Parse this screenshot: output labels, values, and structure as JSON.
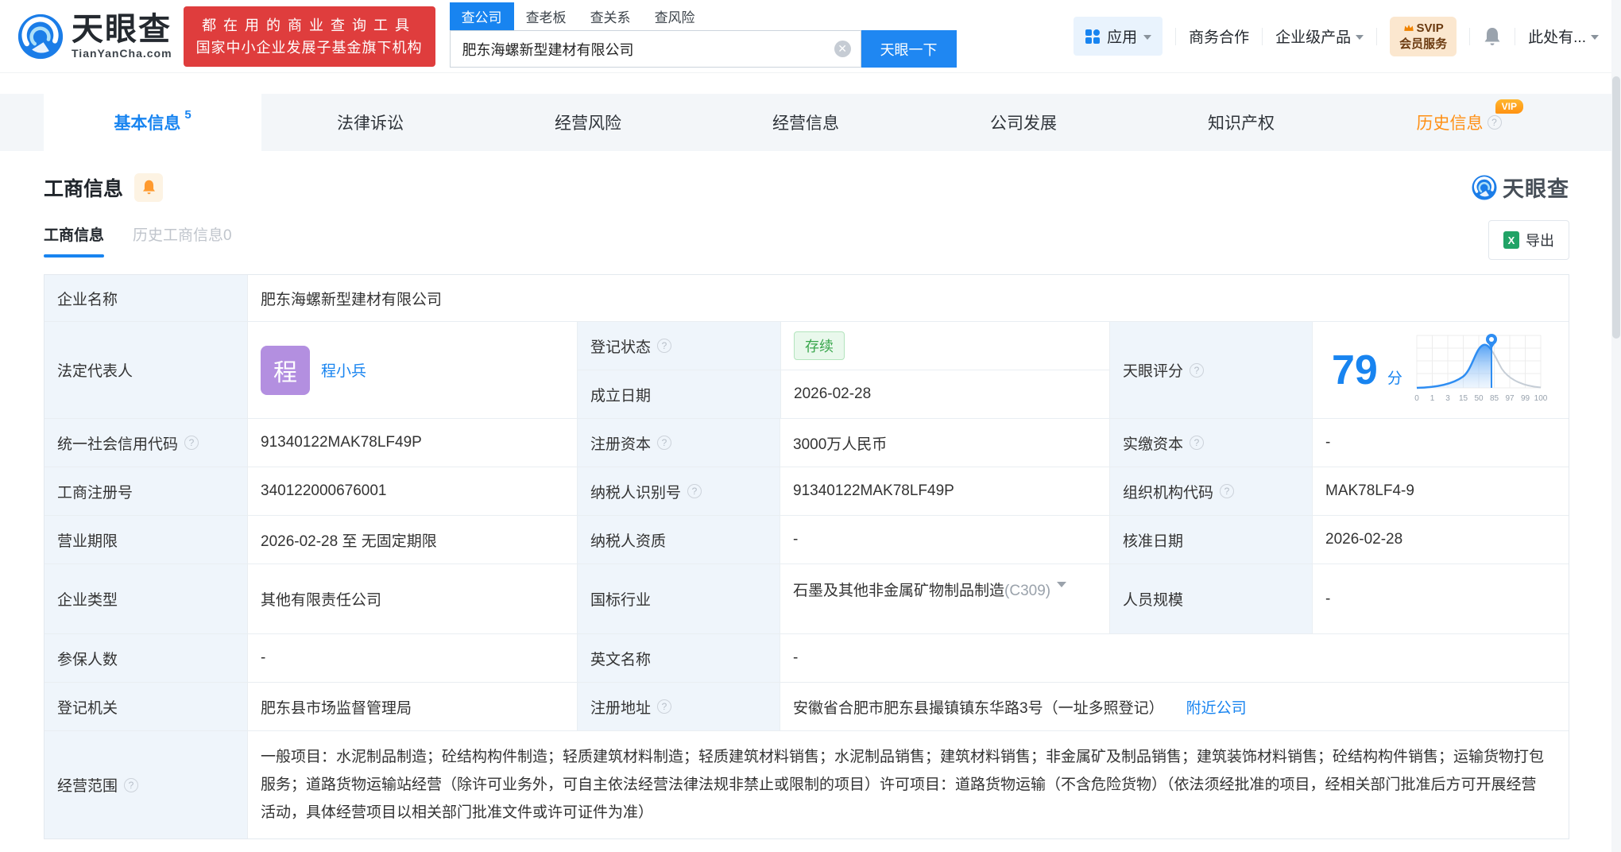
{
  "header": {
    "brand": "天眼查",
    "brand_domain": "TianYanCha.com",
    "promo_line1": "都在用的商业查询工具",
    "promo_line2": "国家中小企业发展子基金旗下机构",
    "search_tabs": {
      "company": "查公司",
      "boss": "查老板",
      "relation": "查关系",
      "risk": "查风险"
    },
    "search_value": "肥东海螺新型建材有限公司",
    "search_button": "天眼一下",
    "nav_apps": "应用",
    "nav_coop": "商务合作",
    "nav_enterprise": "企业级产品",
    "svip_line1": "SVIP",
    "svip_line2": "会员服务",
    "nav_user": "此处有..."
  },
  "tabs": {
    "basic": "基本信息",
    "basic_count": "5",
    "legal": "法律诉讼",
    "risk": "经营风险",
    "operation": "经营信息",
    "development": "公司发展",
    "ip": "知识产权",
    "history": "历史信息",
    "history_vip": "VIP"
  },
  "section": {
    "title": "工商信息",
    "watermark_brand": "天眼查",
    "subtab_current": "工商信息",
    "subtab_history": "历史工商信息0",
    "export_label": "导出",
    "export_icon": "X"
  },
  "info": {
    "company_name_label": "企业名称",
    "company_name": "肥东海螺新型建材有限公司",
    "legal_rep_label": "法定代表人",
    "legal_rep_avatar": "程",
    "legal_rep_name": "程小兵",
    "reg_status_label": "登记状态",
    "reg_status_value": "存续",
    "establish_label": "成立日期",
    "establish_value": "2026-02-28",
    "score_label": "天眼评分",
    "score_value": "79",
    "score_unit": "分",
    "credit_code_label": "统一社会信用代码",
    "credit_code_value": "91340122MAK78LF49P",
    "reg_capital_label": "注册资本",
    "reg_capital_value": "3000万人民币",
    "paid_capital_label": "实缴资本",
    "paid_capital_value": "-",
    "reg_number_label": "工商注册号",
    "reg_number_value": "340122000676001",
    "taxpayer_id_label": "纳税人识别号",
    "taxpayer_id_value": "91340122MAK78LF49P",
    "org_code_label": "组织机构代码",
    "org_code_value": "MAK78LF4-9",
    "business_term_label": "营业期限",
    "business_term_value": "2026-02-28 至 无固定期限",
    "taxpayer_quality_label": "纳税人资质",
    "taxpayer_quality_value": "-",
    "approval_date_label": "核准日期",
    "approval_date_value": "2026-02-28",
    "company_type_label": "企业类型",
    "company_type_value": "其他有限责任公司",
    "industry_label": "国标行业",
    "industry_value": "石墨及其他非金属矿物制品制造",
    "industry_code": "(C309)",
    "staff_size_label": "人员规模",
    "staff_size_value": "-",
    "insured_label": "参保人数",
    "insured_value": "-",
    "english_name_label": "英文名称",
    "english_name_value": "-",
    "reg_authority_label": "登记机关",
    "reg_authority_value": "肥东县市场监督管理局",
    "reg_address_label": "注册地址",
    "reg_address_value": "安徽省合肥市肥东县撮镇镇东华路3号（一址多照登记）",
    "nearby_link": "附近公司",
    "business_scope_label": "经营范围",
    "business_scope_value": "一般项目：水泥制品制造；砼结构构件制造；轻质建筑材料制造；轻质建筑材料销售；水泥制品销售；建筑材料销售；非金属矿及制品销售；建筑装饰材料销售；砼结构构件销售；运输货物打包服务；道路货物运输站经营（除许可业务外，可自主依法经营法律法规非禁止或限制的项目）许可项目：道路货物运输（不含危险货物）（依法须经批准的项目，经相关部门批准后方可开展经营活动，具体经营项目以相关部门批准文件或许可证件为准）"
  },
  "score_chart": {
    "type": "area",
    "score": 79,
    "ticks": [
      "0",
      "1",
      "3",
      "15",
      "50",
      "85",
      "97",
      "99",
      "100"
    ]
  },
  "colors": {
    "primary_blue": "#1884f0",
    "brand_red": "#df3d3d",
    "badge_green": "#39a64c",
    "orange": "#ff9015",
    "avatar_purple": "#b38fe0",
    "label_bg": "#eff5fb"
  }
}
